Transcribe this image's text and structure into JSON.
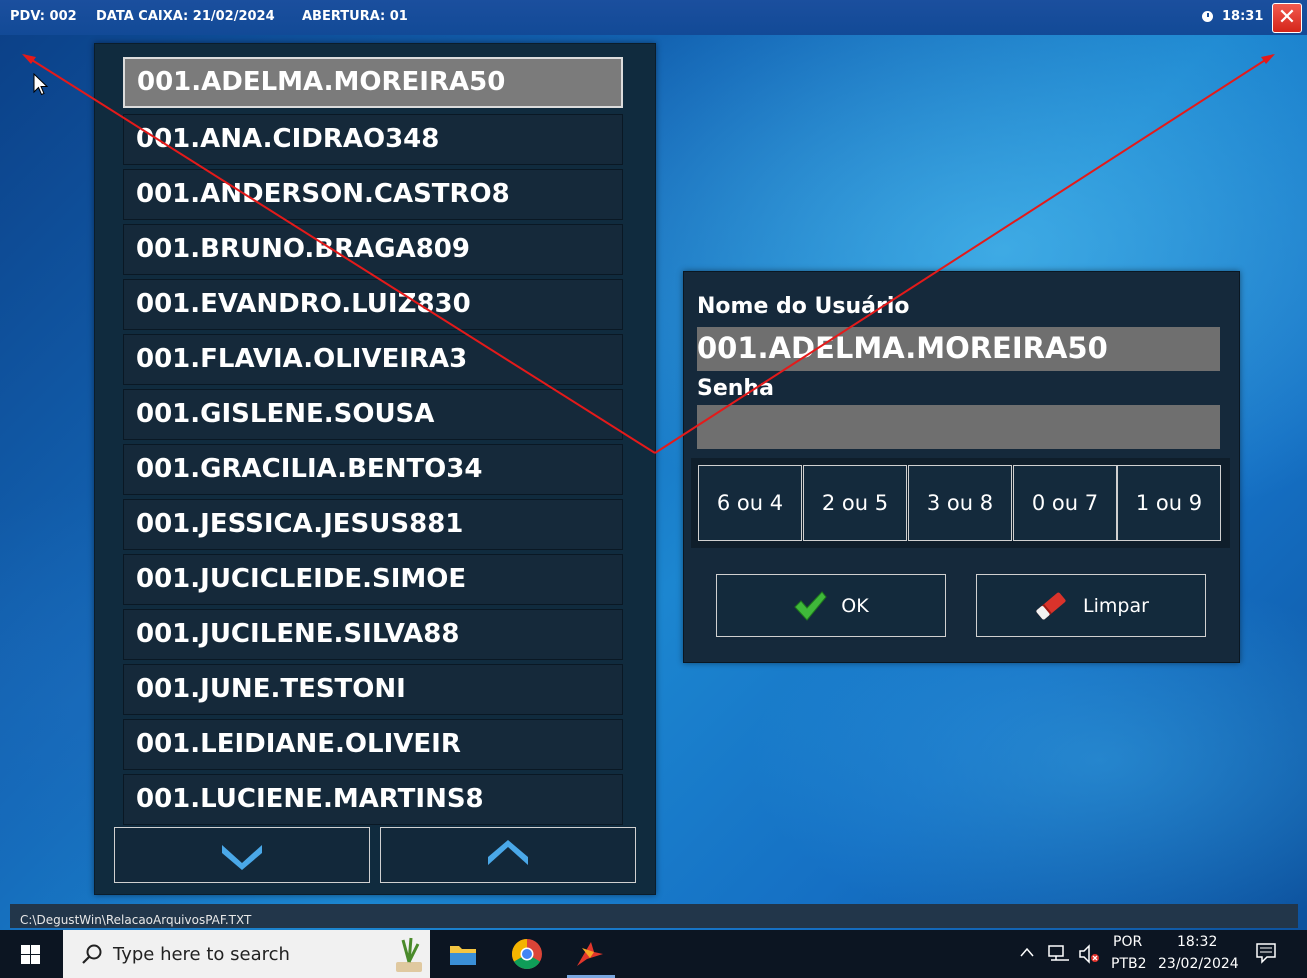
{
  "top_bar": {
    "pdv": "PDV: 002",
    "data_caixa": "DATA CAIXA: 21/02/2024",
    "abertura": "ABERTURA: 01",
    "time": "18:31",
    "close_glyph": "✕",
    "clock_icon": "clock-icon",
    "bg_color": "#124a97"
  },
  "user_list": {
    "items": [
      "001.ADELMA.MOREIRA50",
      "001.ANA.CIDRAO348",
      "001.ANDERSON.CASTRO8",
      "001.BRUNO.BRAGA809",
      "001.EVANDRO.LUIZ830",
      "001.FLAVIA.OLIVEIRA3",
      "001.GISLENE.SOUSA",
      "001.GRACILIA.BENTO34",
      "001.JESSICA.JESUS881",
      "001.JUCICLEIDE.SIMOE",
      "001.JUCILENE.SILVA88",
      "001.JUNE.TESTONI",
      "001.LEIDIANE.OLIVEIR",
      "001.LUCIENE.MARTINS8"
    ],
    "selected": "001.ADELMA.MOREIRA50",
    "scroll_down_icon": "chevron-down-icon",
    "scroll_up_icon": "chevron-up-icon",
    "accent_color": "#4aa8e8"
  },
  "login": {
    "user_label": "Nome do Usuário",
    "user_value": "001.ADELMA.MOREIRA50",
    "password_label": "Senha",
    "password_value": "",
    "keypad": [
      "6 ou 4",
      "2 ou 5",
      "3 ou 8",
      "0 ou 7",
      "1 ou 9"
    ],
    "ok_label": "OK",
    "clear_label": "Limpar",
    "ok_icon": "checkmark-icon",
    "clear_icon": "eraser-icon"
  },
  "status_path": "C:\\DegustWin\\RelacaoArquivosPAF.TXT",
  "taskbar": {
    "search_placeholder": "Type here to search",
    "language": "POR",
    "keyboard": "PTB2",
    "time": "18:32",
    "date": "23/02/2024",
    "icons": [
      "windows-start-icon",
      "search-icon",
      "file-explorer-icon",
      "chrome-icon",
      "app-icon",
      "chevron-up-icon",
      "network-icon",
      "speaker-muted-icon",
      "notification-icon"
    ]
  }
}
